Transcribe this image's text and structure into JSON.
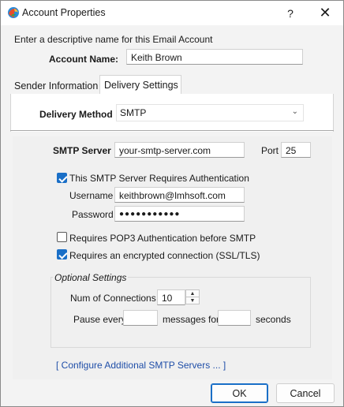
{
  "window": {
    "title": "Account Properties",
    "help_label": "?",
    "close_label": "✕"
  },
  "header": {
    "description": "Enter a descriptive name for this Email Account",
    "account_name_label": "Account Name:",
    "account_name_value": "Keith Brown"
  },
  "tabs": [
    {
      "label": "Sender Information",
      "active": false
    },
    {
      "label": "Delivery Settings",
      "active": true
    }
  ],
  "delivery": {
    "method_label": "Delivery Method",
    "method_value": "SMTP"
  },
  "smtp": {
    "server_label": "SMTP Server",
    "server_value": "your-smtp-server.com",
    "port_label": "Port",
    "port_value": "25",
    "requires_auth_label": "This SMTP Server Requires Authentication",
    "requires_auth_checked": true,
    "username_label": "Username",
    "username_value": "keithbrown@lmhsoft.com",
    "password_label": "Password",
    "password_value": "●●●●●●●●●●●",
    "pop3_label": "Requires POP3 Authentication before SMTP",
    "pop3_checked": false,
    "ssl_label": "Requires an encrypted connection (SSL/TLS)",
    "ssl_checked": true
  },
  "optional": {
    "title": "Optional Settings",
    "connections_label": "Num of Connections",
    "connections_value": "10",
    "pause_label": "Pause every",
    "pause_value": "",
    "messages_for_label": "messages for",
    "seconds_value": "",
    "seconds_label": "seconds"
  },
  "link": {
    "label": "[ Configure Additional SMTP Servers ... ]"
  },
  "buttons": {
    "ok": "OK",
    "cancel": "Cancel"
  },
  "colors": {
    "accent": "#1a6fc7",
    "link": "#1f4ea8"
  }
}
